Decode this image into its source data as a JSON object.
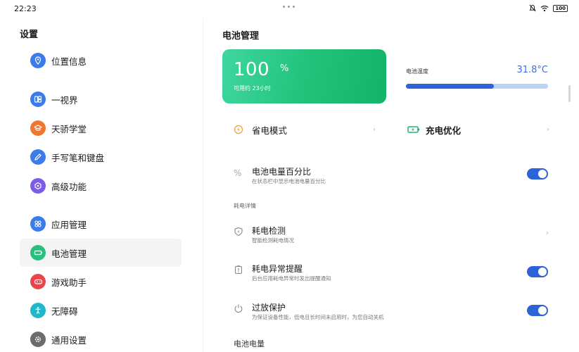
{
  "status_bar": {
    "time": "22:23",
    "battery_text": "100"
  },
  "sidebar": {
    "title": "设置",
    "items": [
      {
        "label": "位置信息",
        "icon": "location-icon",
        "color": "#3b7bea"
      },
      {
        "label": "一视界",
        "icon": "multi-window-icon",
        "color": "#3b7bea"
      },
      {
        "label": "天骄学堂",
        "icon": "graduation-icon",
        "color": "#f0772f"
      },
      {
        "label": "手写笔和键盘",
        "icon": "pen-icon",
        "color": "#3b7bea"
      },
      {
        "label": "高级功能",
        "icon": "features-icon",
        "color": "#7b5ce6"
      },
      {
        "label": "应用管理",
        "icon": "apps-icon",
        "color": "#3b7bea"
      },
      {
        "label": "电池管理",
        "icon": "battery-icon",
        "color": "#2bbf7d",
        "active": true
      },
      {
        "label": "游戏助手",
        "icon": "gamepad-icon",
        "color": "#e8464a"
      },
      {
        "label": "无障碍",
        "icon": "accessibility-icon",
        "color": "#1fb7c9"
      },
      {
        "label": "通用设置",
        "icon": "gear-icon",
        "color": "#6b6b6b"
      }
    ]
  },
  "main": {
    "title": "电池管理",
    "battery_card": {
      "percent": "100",
      "unit": "%",
      "remaining": "可用约 23小时"
    },
    "temperature": {
      "label": "电池温度",
      "value": "31.8°C",
      "level": 0.62
    },
    "power_saving": {
      "label": "省电模式"
    },
    "charge_optimization": {
      "label": "充电优化"
    },
    "battery_percentage": {
      "title": "电池电量百分比",
      "subtitle": "在状态栏中显示电池电量百分比",
      "enabled": true
    },
    "details_section": "耗电详情",
    "consumption_check": {
      "title": "耗电检测",
      "subtitle": "智能检测耗电情况"
    },
    "abnormal_alert": {
      "title": "耗电异常提醒",
      "subtitle": "后台应用耗电异常时发出提醒通知",
      "enabled": true
    },
    "discharge_protection": {
      "title": "过放保护",
      "subtitle": "为保证设备性能，低电且长时间未启用时，为您自动关机",
      "enabled": true
    },
    "battery_level_section": "电池电量"
  },
  "colors": {
    "accent": "#2c63d8",
    "battery_green": "#22c37b"
  }
}
